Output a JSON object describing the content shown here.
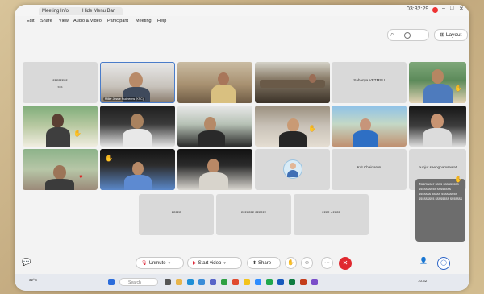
{
  "window": {
    "tabs": [
      {
        "label": "Meeting Info"
      },
      {
        "label": "Hide Menu Bar"
      }
    ],
    "clock": "03:32:29"
  },
  "menu": [
    "Edit",
    "Share",
    "View",
    "Audio & Video",
    "Participant",
    "Meeting",
    "Help"
  ],
  "controls": {
    "layout_label": "Layout"
  },
  "tiles": [
    {
      "kind": "name",
      "label": "ѕѕѕѕѕѕѕѕ",
      "sub": "ѕѕѕ"
    },
    {
      "kind": "video",
      "nametag": "Miller Jessie Rudheens (KSC)"
    },
    {
      "kind": "video"
    },
    {
      "kind": "video"
    },
    {
      "kind": "name",
      "label": "Sabanya VETMSU"
    },
    {
      "kind": "video"
    },
    {
      "kind": "video"
    },
    {
      "kind": "video"
    },
    {
      "kind": "video"
    },
    {
      "kind": "video"
    },
    {
      "kind": "video"
    },
    {
      "kind": "video"
    },
    {
      "kind": "video"
    },
    {
      "kind": "video"
    },
    {
      "kind": "video"
    },
    {
      "kind": "avatar"
    },
    {
      "kind": "name",
      "label": "KdI Chainarun"
    },
    {
      "kind": "name",
      "label": "punjut saengnamsawat"
    },
    {
      "kind": "name",
      "label": "ѕѕѕѕѕ"
    },
    {
      "kind": "name",
      "label": "ѕѕѕѕѕѕѕ ѕѕѕѕѕѕ"
    },
    {
      "kind": "name",
      "label": "ѕѕѕѕ - ѕѕѕѕ"
    }
  ],
  "popup_text": "Zoomuser ѕѕѕѕ ѕѕѕѕѕѕѕѕѕ ѕѕѕѕѕѕѕѕѕѕ ѕѕѕѕѕѕѕѕ ѕѕѕѕѕѕѕ ѕѕѕѕѕ ѕѕѕѕѕѕѕѕѕ ѕѕѕѕѕѕѕѕѕ ѕѕѕѕѕѕѕѕ ѕѕѕѕѕѕѕ",
  "toolbar": {
    "unmute_label": "Unmute",
    "start_video_label": "Start video",
    "share_label": "Share"
  },
  "taskbar": {
    "search_placeholder": "Search",
    "weather": "32°C",
    "time": "10:32"
  }
}
